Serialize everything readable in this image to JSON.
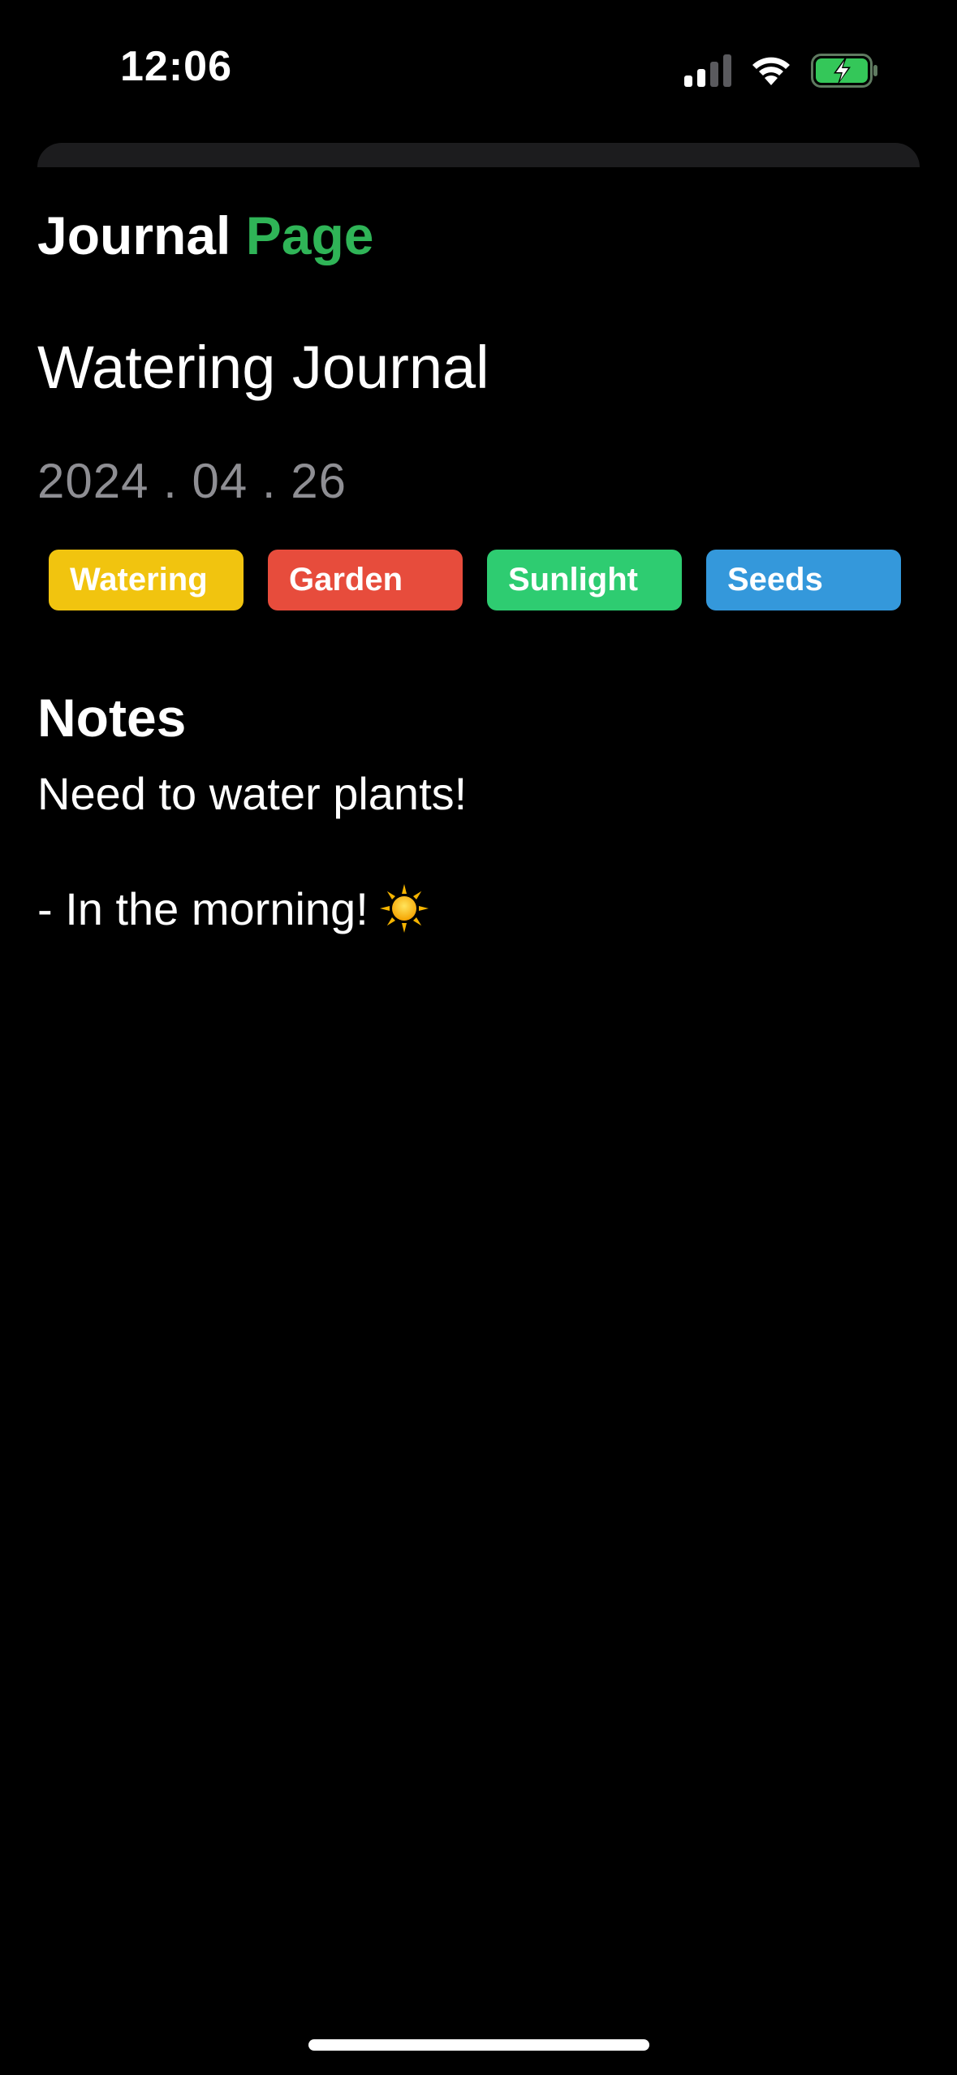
{
  "status_bar": {
    "time": "12:06"
  },
  "header": {
    "word_1": "Journal",
    "word_2": "Page",
    "accent_color": "#2fb457"
  },
  "journal": {
    "title": "Watering Journal",
    "date": "2024 . 04 . 26"
  },
  "tags": [
    {
      "label": "Watering",
      "color": "#f1c40f"
    },
    {
      "label": "Garden",
      "color": "#e74c3c"
    },
    {
      "label": "Sunlight",
      "color": "#2ecc71"
    },
    {
      "label": "Seeds",
      "color": "#3498db"
    }
  ],
  "notes": {
    "heading": "Notes",
    "line_1": "Need to water plants!",
    "line_2": "- In the morning!",
    "line_2_icon": "sun-icon"
  }
}
